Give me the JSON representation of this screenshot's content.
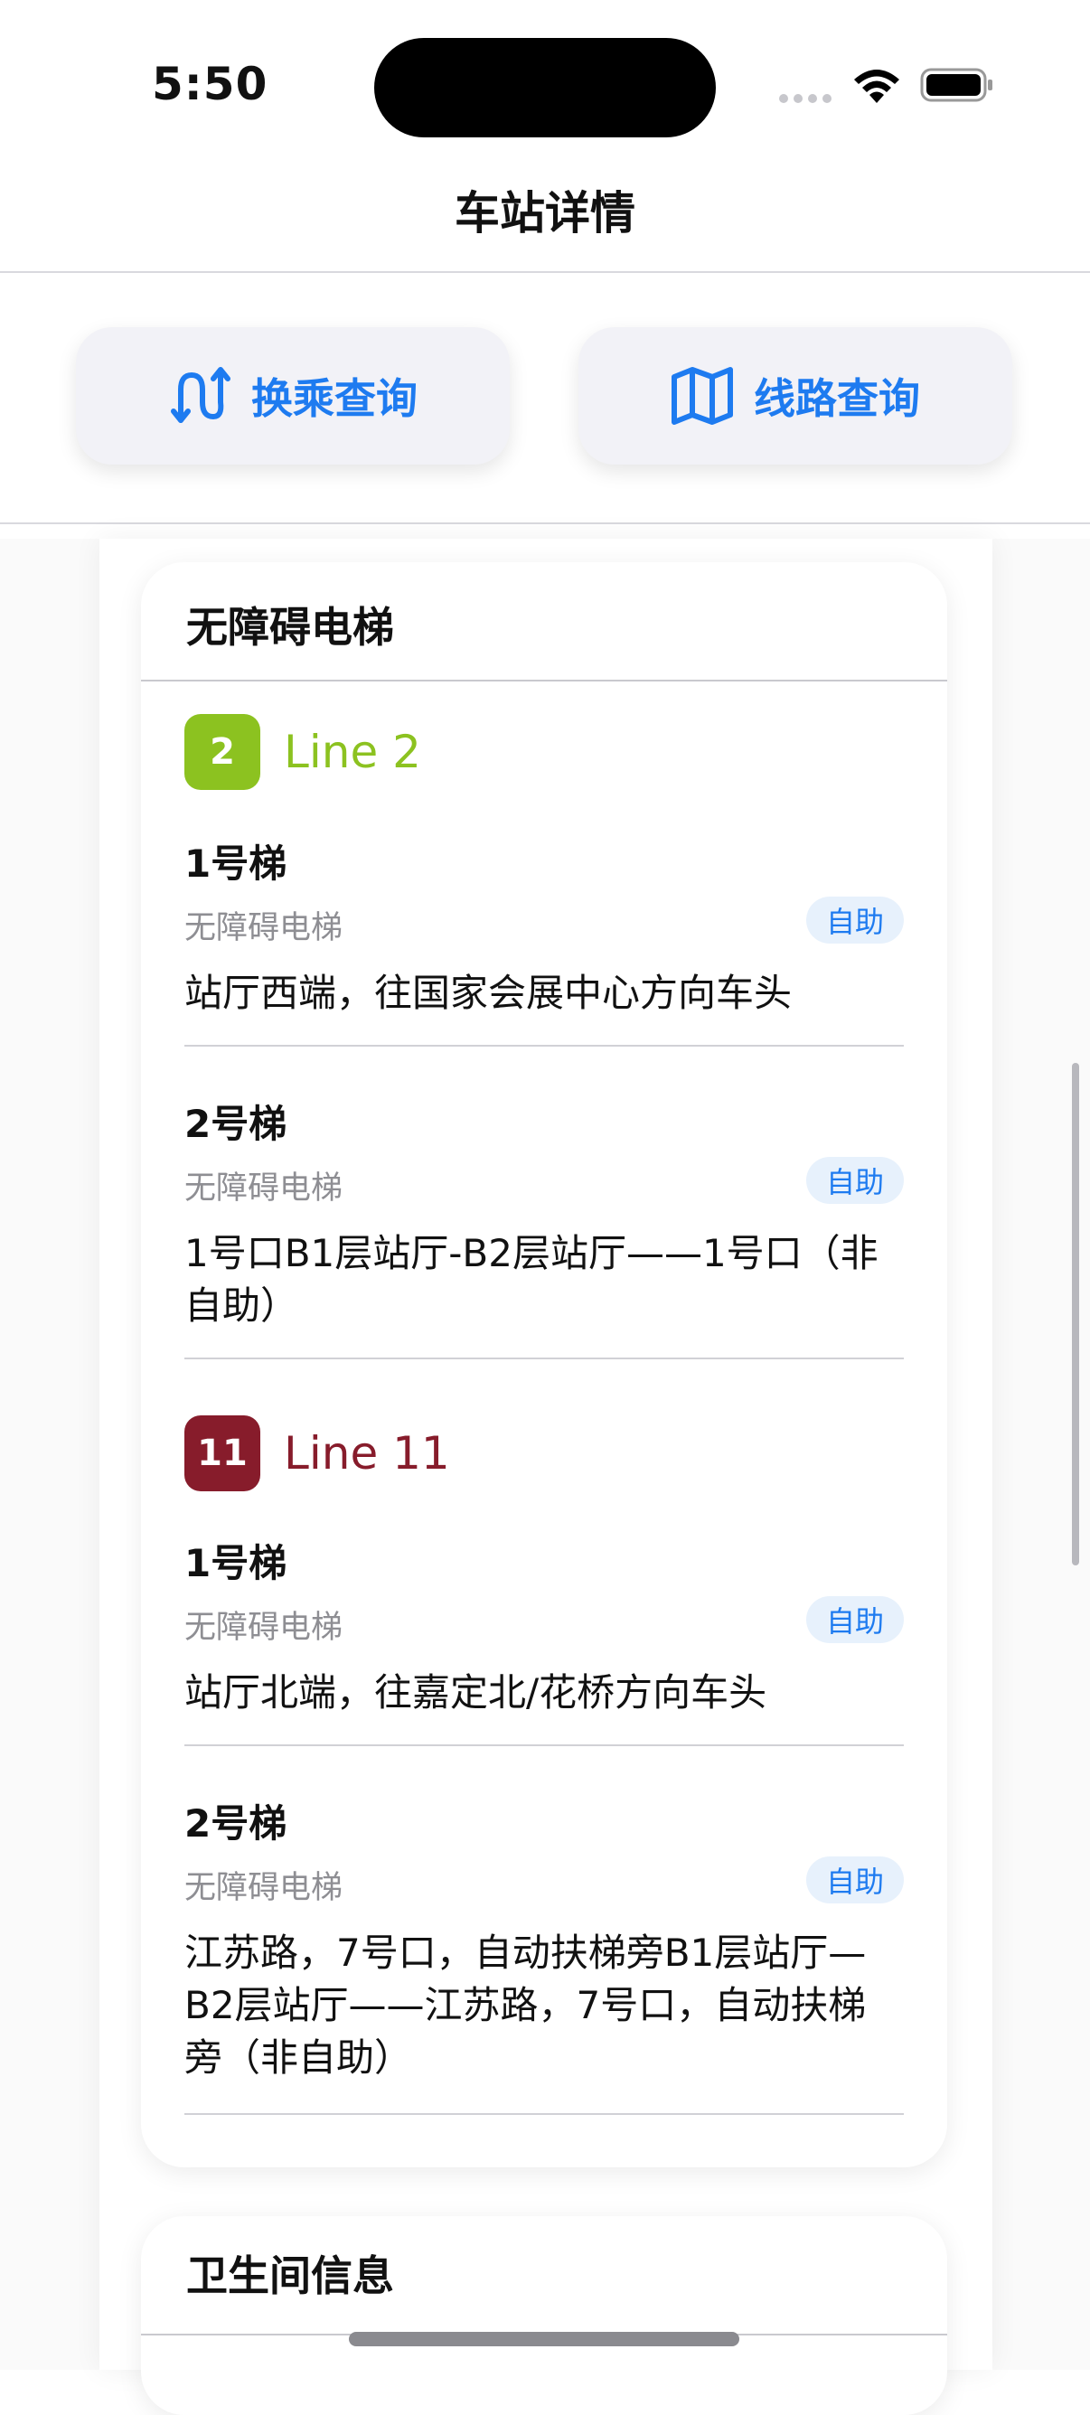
{
  "status_bar": {
    "time": "5:50"
  },
  "nav": {
    "title": "车站详情"
  },
  "actions": {
    "transfer_label": "换乘查询",
    "route_label": "线路查询",
    "accent_color": "#1E7BF0"
  },
  "elevator_card": {
    "title": "无障碍电梯",
    "lines": [
      {
        "badge": "2",
        "name": "Line 2",
        "color": "#8CC220",
        "entries": [
          {
            "name": "1号梯",
            "type": "无障碍电梯",
            "tag": "自助",
            "desc": "站厅西端，往国家会展中心方向车头"
          },
          {
            "name": "2号梯",
            "type": "无障碍电梯",
            "tag": "自助",
            "desc": "1号口B1层站厅-B2层站厅——1号口（非自助）"
          }
        ]
      },
      {
        "badge": "11",
        "name": "Line 11",
        "color": "#871C2B",
        "entries": [
          {
            "name": "1号梯",
            "type": "无障碍电梯",
            "tag": "自助",
            "desc": "站厅北端，往嘉定北/花桥方向车头"
          },
          {
            "name": "2号梯",
            "type": "无障碍电梯",
            "tag": "自助",
            "desc": "江苏路，7号口，自动扶梯旁B1层站厅—B2层站厅——江苏路，7号口，自动扶梯旁（非自助）"
          }
        ]
      }
    ]
  },
  "restroom_card": {
    "title": "卫生间信息"
  }
}
